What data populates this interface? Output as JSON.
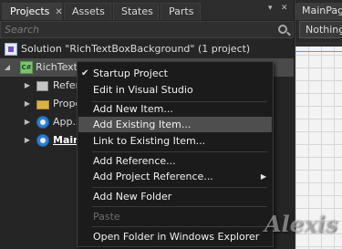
{
  "tabs": [
    {
      "label": "Projects",
      "close": "✕"
    },
    {
      "label": "Assets"
    },
    {
      "label": "States"
    },
    {
      "label": "Parts"
    }
  ],
  "panel_controls": {
    "pin": "▾",
    "close": "✕"
  },
  "search": {
    "placeholder": "Search"
  },
  "tree": {
    "solution": "Solution \"RichTextBoxBackground\" (1 project)",
    "project": "RichTextBoxBackground",
    "items": [
      "References",
      "Properties",
      "App.xaml",
      "MainPage.xaml"
    ]
  },
  "right_panel": {
    "tab": "MainPage.xaml",
    "dropdown": "Nothing"
  },
  "context_menu": {
    "startup_project": "Startup Project",
    "edit_vs": "Edit in Visual Studio",
    "add_new_item": "Add New Item...",
    "add_existing_item": "Add Existing Item...",
    "link_existing_item": "Link to Existing Item...",
    "add_reference": "Add Reference...",
    "add_project_reference": "Add Project Reference...",
    "add_new_folder": "Add New Folder",
    "paste": "Paste",
    "open_folder": "Open Folder in Windows Explorer"
  },
  "icons": {
    "check": "checkmark-icon",
    "submenu": "chevron-right-icon"
  },
  "watermark": "Alexis",
  "colors": {
    "menu_bg": "#1b1b1c",
    "menu_highlight": "#4e4e4e",
    "panel_bg": "#252526"
  }
}
